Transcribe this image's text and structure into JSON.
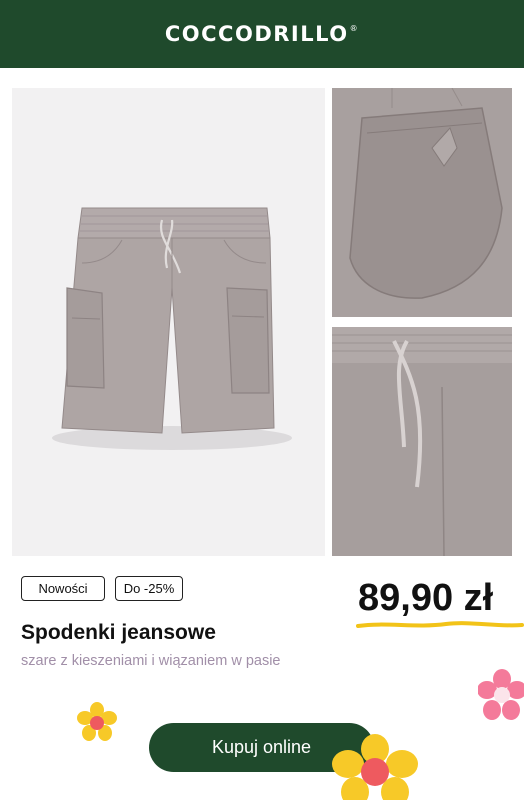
{
  "header": {
    "brand": "COCCODRILLO",
    "brand_mark": "®"
  },
  "gallery": {
    "main_image": "product-photo-shorts-front",
    "detail_image_1": "product-photo-pocket-detail",
    "detail_image_2": "product-photo-waistband-detail"
  },
  "badges": {
    "new": "Nowości",
    "sale": "Do -25%"
  },
  "product": {
    "price": "89,90 zł",
    "name": "Spodenki jeansowe",
    "description": "szare z kieszeniami i wiązaniem w pasie"
  },
  "cta": {
    "label": "Kupuj online"
  },
  "colors": {
    "brand_green": "#1f4a2c",
    "fabric_gray": "#a9a09f",
    "underline_yellow": "#f2c318",
    "subtitle_mauve": "#a18fa8",
    "flower_yellow": "#f7c928",
    "flower_pink": "#f47a9a"
  },
  "decorations": [
    "yellow-flower-icon",
    "pink-flower-icon"
  ]
}
